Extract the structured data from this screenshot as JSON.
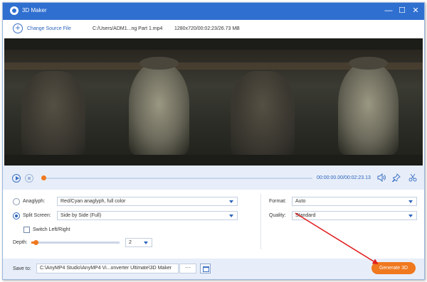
{
  "window": {
    "title": "3D Maker",
    "minimize_glyph": "—",
    "maximize_glyph": "☐",
    "close_glyph": "✕"
  },
  "toolbar": {
    "change_source_label": "Change Source File",
    "file_path": "C:/Users/ADM1...ng Part 1.mp4",
    "file_meta": "1280x720/00:02:23/26.73 MB"
  },
  "playback": {
    "current_time": "00:00:00.00",
    "total_time": "00:02:23.13",
    "separator": "/",
    "progress": 0
  },
  "settings": {
    "anaglyph": {
      "label": "Anaglyph:",
      "selected": false,
      "value": "Red/Cyan anaglyph, full color"
    },
    "split_screen": {
      "label": "Split Screen:",
      "selected": true,
      "value": "Side by Side (Full)"
    },
    "switch_lr": {
      "label": "Switch Left/Right",
      "checked": false
    },
    "depth": {
      "label": "Depth:",
      "value": "2"
    },
    "format": {
      "label": "Format:",
      "value": "Auto"
    },
    "quality": {
      "label": "Quality:",
      "value": "Standard"
    }
  },
  "footer": {
    "save_to_label": "Save to:",
    "save_path": "C:\\AnyMP4 Studio\\AnyMP4 Vi...onverter Ultimate\\3D Maker",
    "browse_label": "···",
    "generate_label": "Generate 3D"
  },
  "colors": {
    "titlebar": "#2f6fd0",
    "accent": "#f0781e",
    "link": "#2c63bd",
    "arrow": "#e02020"
  },
  "icons": {
    "app": "3d-maker-logo-icon",
    "add": "plus-circle-icon",
    "play": "play-icon",
    "stop": "stop-icon",
    "volume": "volume-icon",
    "pin": "pin-icon",
    "cut": "scissors-icon",
    "folder": "folder-icon"
  }
}
